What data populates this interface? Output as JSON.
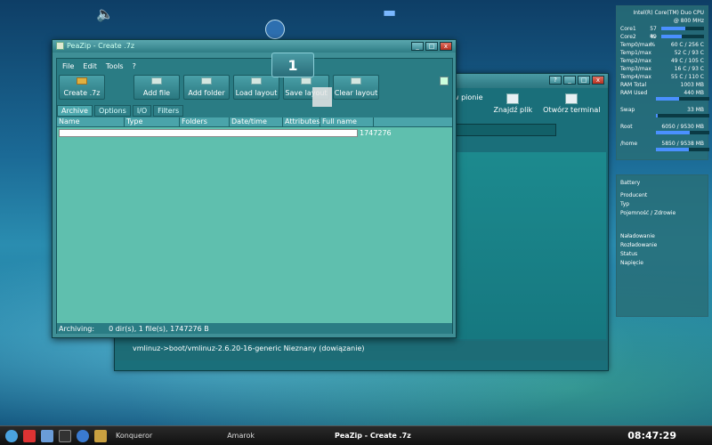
{
  "desktop": {
    "speaker_icon": "speaker-icon",
    "folder_icon": "folder-icon",
    "globe_icon": "globe-icon"
  },
  "konqueror": {
    "toolbar": [
      {
        "label": "w pionie",
        "icon": "split-icon"
      },
      {
        "label": "Znajdź plik",
        "icon": "find-icon"
      },
      {
        "label": "Otwórz terminal",
        "icon": "terminal-icon"
      }
    ],
    "status": "vmlinuz->boot/vmlinuz-2.6.20-16-generic  Nieznany (dowiązanie)"
  },
  "peazip": {
    "title": "PeaZip - Create .7z",
    "menu": [
      "File",
      "Edit",
      "Tools",
      "?"
    ],
    "toolbar": {
      "create": "Create .7z",
      "add_file": "Add file",
      "add_folder": "Add folder",
      "load_layout": "Load layout",
      "save_layout": "Save layout",
      "clear_layout": "Clear layout"
    },
    "tabs": [
      "Archive",
      "Options",
      "I/O",
      "Filters"
    ],
    "columns": [
      "Name",
      "Type",
      "Folders",
      "Date/time",
      "Attributes",
      "Full name"
    ],
    "size_value": "1747276",
    "status_label": "Archiving:",
    "status_text": "0 dir(s), 1 file(s), 1747276 B"
  },
  "drag_badge": "1",
  "sysmon": {
    "header": "Intel(R) Core(TM) Duo CPU",
    "freq": "@ 800 MHz",
    "cores": [
      {
        "label": "Core1",
        "value": "57 %",
        "fill": 0.57
      },
      {
        "label": "Core2",
        "value": "49 %",
        "fill": 0.49
      }
    ],
    "temps": [
      {
        "label": "Temp0/max",
        "value": "60 C  / 256 C"
      },
      {
        "label": "Temp1/max",
        "value": "52 C  / 93 C"
      },
      {
        "label": "Temp2/max",
        "value": "49 C  / 105 C"
      },
      {
        "label": "Temp3/max",
        "value": "16 C  / 93 C"
      },
      {
        "label": "Temp4/max",
        "value": "55 C  / 110 C"
      }
    ],
    "ram_total_label": "RAM Total",
    "ram_total": "1003 MB",
    "ram_used_label": "RAM Used",
    "ram_used": "440 MB",
    "ram_fill": 0.44,
    "swap_label": "Swap",
    "swap": "33 MB",
    "swap_fill": 0.03,
    "root_label": "Root",
    "root": "6050 / 9530 MB",
    "root_fill": 0.63,
    "home_label": "/home",
    "home": "5850 / 9538 MB",
    "home_fill": 0.61
  },
  "battery": {
    "title": "Battery",
    "rows": [
      "Producent",
      "Typ",
      "Pojemność / Zdrowie",
      "",
      "Naładowanie",
      "Rozładowanie",
      "Status",
      "Napięcie"
    ]
  },
  "panel": {
    "tasks": [
      "Konqueror",
      "Amarok",
      "PeaZip - Create .7z"
    ],
    "clock": "08:47:29"
  },
  "colors": {
    "accent": "#2a7c84",
    "list_bg": "#5fbfae",
    "bar_fill": "#4a90ff"
  }
}
